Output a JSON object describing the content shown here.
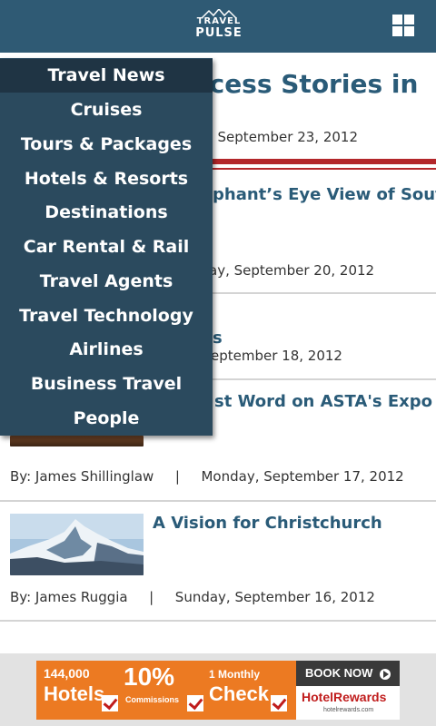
{
  "header": {
    "logo_top": "TRAVEL",
    "logo_bottom": "PULSE",
    "menu_icon": "grid-icon"
  },
  "featured": {
    "title_visible": "ccess Stories in",
    "date_visible": ", September 23, 2012"
  },
  "articles": [
    {
      "title_visible": "phant’s Eye View of South",
      "date_visible": "ay, September 20, 2012"
    },
    {
      "title_visible": "s",
      "date_visible": "eptember 18, 2012"
    },
    {
      "title_visible": "st Word on ASTA's Expo",
      "byline": "By: James Shillinglaw",
      "separator": "|",
      "date": "Monday, September 17, 2012"
    },
    {
      "title": "A Vision for Christchurch",
      "byline": "By: James Ruggia",
      "separator": "|",
      "date": "Sunday, September 16, 2012"
    }
  ],
  "menu": {
    "items": [
      {
        "label": "Travel News",
        "active": true
      },
      {
        "label": "Cruises"
      },
      {
        "label": "Tours & Packages"
      },
      {
        "label": "Hotels & Resorts"
      },
      {
        "label": "Destinations"
      },
      {
        "label": "Car Rental & Rail"
      },
      {
        "label": "Travel Agents"
      },
      {
        "label": "Travel Technology"
      },
      {
        "label": "Airlines"
      },
      {
        "label": "Business Travel"
      },
      {
        "label": "People"
      }
    ]
  },
  "ad": {
    "part1_num": "144,000",
    "part1_word": "Hotels",
    "part2_num": "10%",
    "part2_word": "Commissions",
    "part3_num": "1 Monthly",
    "part3_word": "Check",
    "cta": "BOOK NOW",
    "brand": "HotelRewards",
    "brand_url": "hotelrewards.com"
  },
  "colors": {
    "header": "#2f5a74",
    "menu": "#2b4a5e",
    "title": "#2a5b78",
    "red_rule": "#b3262a",
    "ad_orange": "#ec7a22"
  }
}
